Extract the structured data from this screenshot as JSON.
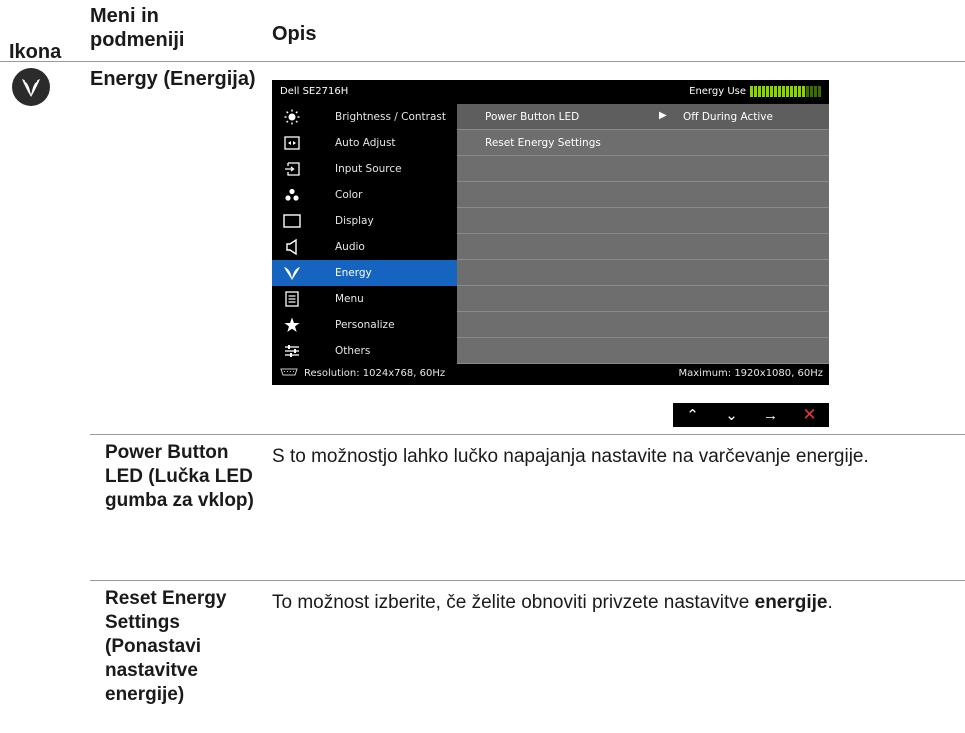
{
  "headers": {
    "icon": "Ikona",
    "menu": "Meni in podmeniji",
    "desc": "Opis"
  },
  "energy": {
    "icon": "leaf-icon",
    "name": "Energy (Energija)"
  },
  "osd": {
    "model": "Dell SE2716H",
    "energy_use_label": "Energy Use",
    "energy_use_level": 0.78,
    "menu_items": [
      {
        "label": "Brightness / Contrast",
        "icon": "brightness-icon"
      },
      {
        "label": "Auto Adjust",
        "icon": "auto-adjust-icon"
      },
      {
        "label": "Input Source",
        "icon": "input-source-icon"
      },
      {
        "label": "Color",
        "icon": "color-icon"
      },
      {
        "label": "Display",
        "icon": "display-icon"
      },
      {
        "label": "Audio",
        "icon": "audio-icon"
      },
      {
        "label": "Energy",
        "icon": "energy-icon"
      },
      {
        "label": "Menu",
        "icon": "menu-icon"
      },
      {
        "label": "Personalize",
        "icon": "star-icon"
      },
      {
        "label": "Others",
        "icon": "others-icon"
      }
    ],
    "active_index": 6,
    "rows": [
      {
        "label": "Power Button LED",
        "value": "Off During Active"
      },
      {
        "label": "Reset Energy Settings",
        "value": ""
      }
    ],
    "resolution": "Resolution: 1024x768, 60Hz",
    "maximum": "Maximum: 1920x1080, 60Hz",
    "nav_icons": [
      "up-icon",
      "down-icon",
      "right-icon",
      "close-icon"
    ]
  },
  "subitems": [
    {
      "name": "Power Button LED (Lučka LED gumba za vklop)",
      "desc": "S to možnostjo lahko lučko napajanja nastavite na varčevanje energije."
    },
    {
      "name": "Reset Energy Settings (Ponastavi nastavitve energije)",
      "desc_prefix": "To možnost izberite, če želite obnoviti privzete nastavitve ",
      "desc_bold": "energije",
      "desc_suffix": "."
    }
  ]
}
